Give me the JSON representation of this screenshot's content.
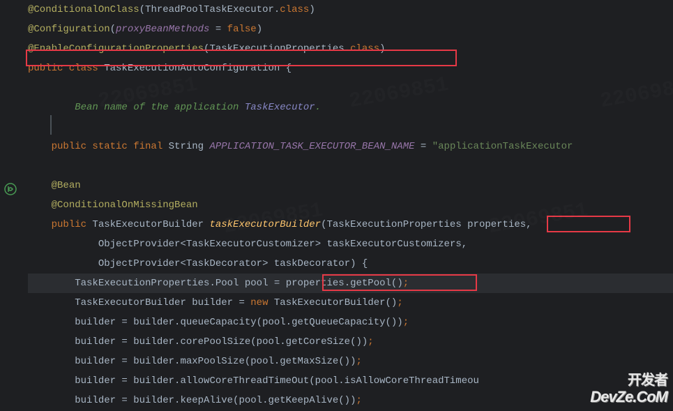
{
  "code": {
    "line1": {
      "a": "@ConditionalOnClass",
      "p1": "(",
      "t1": "ThreadPoolTaskExecutor",
      "d1": ".",
      "k1": "class",
      "p2": ")"
    },
    "line2": {
      "a": "@Configuration",
      "p1": "(",
      "f": "proxyBeanMethods",
      "eq": " = ",
      "k": "false",
      "p2": ")"
    },
    "line3": {
      "a": "@EnableConfigurationProperties",
      "p1": "(",
      "t": "TaskExecutionProperties",
      "d": ".",
      "k": "class",
      "p2": ")"
    },
    "line4": {
      "k1": "public class ",
      "t": "TaskExecutionAutoConfiguration ",
      "b": "{"
    },
    "line6": {
      "doc1": "Bean name of the application ",
      "doc2": "TaskExecutor",
      "doc3": "."
    },
    "line8": {
      "k1": "public static final ",
      "t": "String ",
      "f": "APPLICATION_TASK_EXECUTOR_BEAN_NAME",
      "eq": " = ",
      "s": "\"applicationTaskExecutor"
    },
    "line10": {
      "a": "@Bean"
    },
    "line11": {
      "a": "@ConditionalOnMissingBean"
    },
    "line12": {
      "k": "public ",
      "t1": "TaskExecutorBuilder ",
      "m": "taskExecutorBuilder",
      "p1": "(",
      "t2": "TaskExecutionProperties ",
      "param": "properties",
      "c": ","
    },
    "line13": {
      "t1": "ObjectProvider",
      "lt": "<",
      "t2": "TaskExecutorCustomizer",
      "gt": "> ",
      "p": "taskExecutorCustomizers",
      "c": ","
    },
    "line14": {
      "t1": "ObjectProvider",
      "lt": "<",
      "t2": "TaskDecorator",
      "gt": "> ",
      "p": "taskDecorator",
      "pc": ") {"
    },
    "line15": {
      "t": "TaskExecutionProperties.Pool ",
      "v": "pool ",
      "eq": "= ",
      "e": "properties.getPool()",
      "sc": ";"
    },
    "line16": {
      "t": "TaskExecutorBuilder ",
      "v": "builder ",
      "eq": "= ",
      "k": "new ",
      "e": "TaskExecutorBuilder()",
      "sc": ";"
    },
    "line17": {
      "e": "builder = builder.queueCapacity(pool.getQueueCapacity())",
      "sc": ";"
    },
    "line18": {
      "e": "builder = builder.corePoolSize(pool.getCoreSize())",
      "sc": ";"
    },
    "line19": {
      "e": "builder = builder.maxPoolSize(pool.getMaxSize())",
      "sc": ";"
    },
    "line20": {
      "e": "builder = builder.allowCoreThreadTimeOut(pool.isAllowCoreThreadTimeou"
    },
    "line21": {
      "e": "builder = builder.keepAlive(pool.getKeepAlive())",
      "sc": ";"
    }
  },
  "watermark": {
    "line1": "开发者",
    "line2": "DevZe.CoM"
  },
  "annotations": {
    "box1": "red-highlight-enable-config-properties",
    "box2": "red-highlight-properties-param",
    "box3": "red-highlight-getpool-call"
  }
}
